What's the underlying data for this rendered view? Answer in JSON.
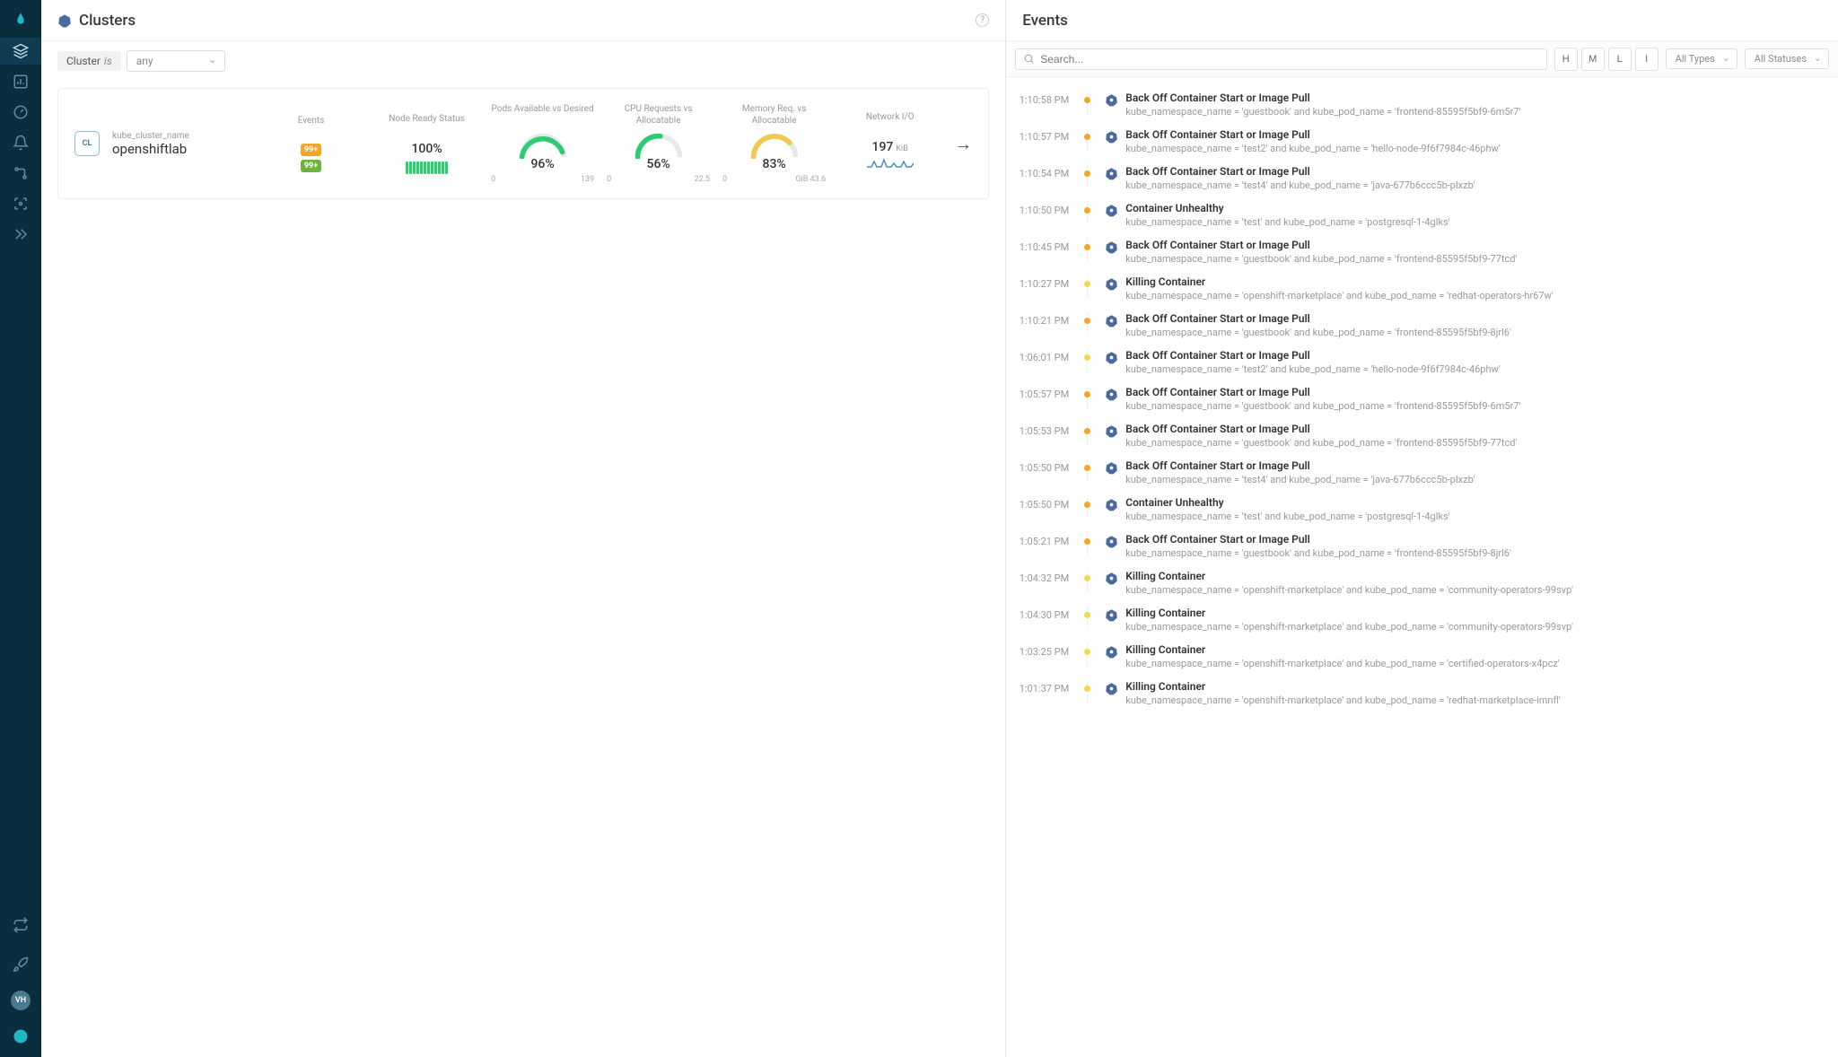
{
  "page_title": "Clusters",
  "events_title": "Events",
  "search": {
    "placeholder": "Search..."
  },
  "severity_buttons": [
    "H",
    "M",
    "L",
    "I"
  ],
  "types_filter": "All Types",
  "statuses_filter": "All Statuses",
  "filter": {
    "field": "Cluster",
    "op": "is",
    "value": "any"
  },
  "cluster": {
    "badge": "CL",
    "name_label": "kube_cluster_name",
    "name": "openshiftlab",
    "events_label": "Events",
    "events_badge1": "99+",
    "events_badge2": "99+",
    "node_ready_label": "Node Ready\nStatus",
    "node_ready": "100%",
    "pods_label": "Pods Available\nvs Desired",
    "pods_val": "96%",
    "pods_min": "0",
    "pods_max": "139",
    "cpu_label": "CPU Requests\nvs Allocatable",
    "cpu_val": "56%",
    "cpu_min": "0",
    "cpu_max": "22.5",
    "mem_label": "Memory Req. vs\nAllocatable",
    "mem_val": "83%",
    "mem_min": "0",
    "mem_unit": "GiB",
    "mem_max": "43.6",
    "net_label": "Network I/O",
    "net_val": "197",
    "net_unit": "KiB"
  },
  "avatar": "VH",
  "events": [
    {
      "time": "1:10:58 PM",
      "sev": "orange",
      "title": "Back Off Container Start or Image Pull",
      "detail": "kube_namespace_name = 'guestbook' and kube_pod_name = 'frontend-85595f5bf9-6m5r7'"
    },
    {
      "time": "1:10:57 PM",
      "sev": "orange",
      "title": "Back Off Container Start or Image Pull",
      "detail": "kube_namespace_name = 'test2' and kube_pod_name = 'hello-node-9f6f7984c-46phw'"
    },
    {
      "time": "1:10:54 PM",
      "sev": "orange",
      "title": "Back Off Container Start or Image Pull",
      "detail": "kube_namespace_name = 'test4' and kube_pod_name = 'java-677b6ccc5b-plxzb'"
    },
    {
      "time": "1:10:50 PM",
      "sev": "orange",
      "title": "Container Unhealthy",
      "detail": "kube_namespace_name = 'test' and kube_pod_name = 'postgresql-1-4glks'"
    },
    {
      "time": "1:10:45 PM",
      "sev": "orange",
      "title": "Back Off Container Start or Image Pull",
      "detail": "kube_namespace_name = 'guestbook' and kube_pod_name = 'frontend-85595f5bf9-77tcd'"
    },
    {
      "time": "1:10:27 PM",
      "sev": "yellow",
      "title": "Killing Container",
      "detail": "kube_namespace_name = 'openshift-marketplace' and kube_pod_name = 'redhat-operators-hr67w'"
    },
    {
      "time": "1:10:21 PM",
      "sev": "orange",
      "title": "Back Off Container Start or Image Pull",
      "detail": "kube_namespace_name = 'guestbook' and kube_pod_name = 'frontend-85595f5bf9-8jrl6'"
    },
    {
      "time": "1:06:01 PM",
      "sev": "yellow",
      "title": "Back Off Container Start or Image Pull",
      "detail": "kube_namespace_name = 'test2' and kube_pod_name = 'hello-node-9f6f7984c-46phw'"
    },
    {
      "time": "1:05:57 PM",
      "sev": "orange",
      "title": "Back Off Container Start or Image Pull",
      "detail": "kube_namespace_name = 'guestbook' and kube_pod_name = 'frontend-85595f5bf9-6m5r7'"
    },
    {
      "time": "1:05:53 PM",
      "sev": "orange",
      "title": "Back Off Container Start or Image Pull",
      "detail": "kube_namespace_name = 'guestbook' and kube_pod_name = 'frontend-85595f5bf9-77tcd'"
    },
    {
      "time": "1:05:50 PM",
      "sev": "orange",
      "title": "Back Off Container Start or Image Pull",
      "detail": "kube_namespace_name = 'test4' and kube_pod_name = 'java-677b6ccc5b-plxzb'"
    },
    {
      "time": "1:05:50 PM",
      "sev": "orange",
      "title": "Container Unhealthy",
      "detail": "kube_namespace_name = 'test' and kube_pod_name = 'postgresql-1-4glks'"
    },
    {
      "time": "1:05:21 PM",
      "sev": "orange",
      "title": "Back Off Container Start or Image Pull",
      "detail": "kube_namespace_name = 'guestbook' and kube_pod_name = 'frontend-85595f5bf9-8jrl6'"
    },
    {
      "time": "1:04:32 PM",
      "sev": "yellow",
      "title": "Killing Container",
      "detail": "kube_namespace_name = 'openshift-marketplace' and kube_pod_name = 'community-operators-99svp'"
    },
    {
      "time": "1:04:30 PM",
      "sev": "yellow",
      "title": "Killing Container",
      "detail": "kube_namespace_name = 'openshift-marketplace' and kube_pod_name = 'community-operators-99svp'"
    },
    {
      "time": "1:03:25 PM",
      "sev": "yellow",
      "title": "Killing Container",
      "detail": "kube_namespace_name = 'openshift-marketplace' and kube_pod_name = 'certified-operators-x4pcz'"
    },
    {
      "time": "1:01:37 PM",
      "sev": "yellow",
      "title": "Killing Container",
      "detail": "kube_namespace_name = 'openshift-marketplace' and kube_pod_name = 'redhat-marketplace-imnfl'"
    }
  ]
}
